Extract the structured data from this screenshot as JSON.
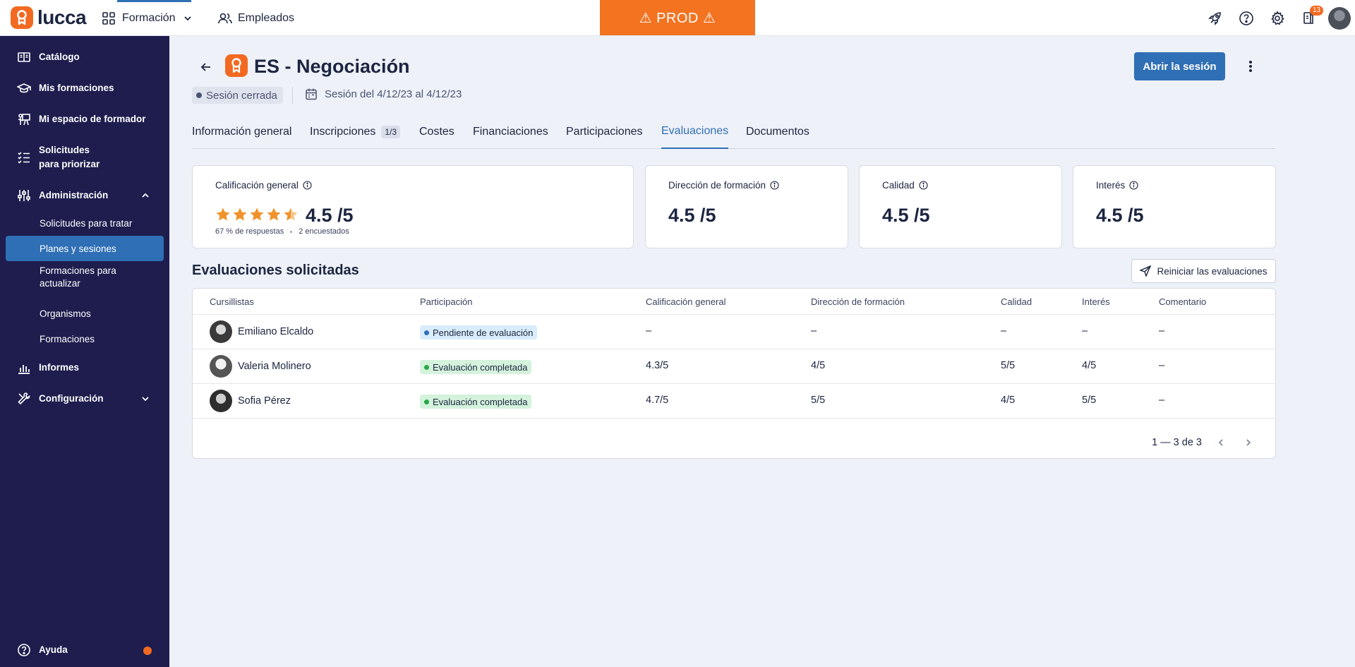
{
  "brand": {
    "name": "lucca",
    "accent": "#f26a21",
    "primary": "#2f6fb5",
    "sidebar_bg": "#1e1d4e"
  },
  "topbar": {
    "app_name": "Formación",
    "employees_link": "Empleados",
    "env_banner": "⚠ PROD ⚠",
    "icons": [
      "rocket-icon",
      "help-icon",
      "settings-icon",
      "notifications-icon"
    ],
    "notifications_count": "13"
  },
  "sidebar": {
    "items": [
      {
        "label": "Catálogo",
        "icon": "catalog-icon"
      },
      {
        "label": "Mis formaciones",
        "icon": "graduation-cap-icon"
      },
      {
        "label": "Mi espacio de formador",
        "icon": "presentation-icon"
      },
      {
        "label": "Solicitudes para priorizar",
        "icon": "list-check-icon"
      },
      {
        "label": "Administración",
        "icon": "sliders-icon",
        "expanded": true
      },
      {
        "label": "Informes",
        "icon": "bar-chart-icon"
      },
      {
        "label": "Configuración",
        "icon": "tools-icon",
        "expanded": false
      }
    ],
    "admin_subitems": [
      {
        "label": "Solicitudes para tratar",
        "active": false
      },
      {
        "label": "Planes y sesiones",
        "active": true
      },
      {
        "label": "Formaciones para actualizar",
        "active": false
      },
      {
        "label": "Organismos",
        "active": false
      },
      {
        "label": "Formaciones",
        "active": false
      }
    ],
    "help_label": "Ayuda"
  },
  "header": {
    "title": "ES - Negociación",
    "status": "Sesión cerrada",
    "dates": "Sesión del 4/12/23 al 4/12/23",
    "open_button": "Abrir la sesión"
  },
  "tabs": [
    {
      "label": "Información general",
      "active": false
    },
    {
      "label": "Inscripciones",
      "count": "1/3",
      "active": false
    },
    {
      "label": "Costes",
      "active": false
    },
    {
      "label": "Financiaciones",
      "active": false
    },
    {
      "label": "Participaciones",
      "active": false
    },
    {
      "label": "Evaluaciones",
      "active": true
    },
    {
      "label": "Documentos",
      "active": false
    }
  ],
  "scores": {
    "overall": {
      "label": "Calificación general",
      "value": "4.5 /5",
      "stars": 4.5,
      "responses": "67 % de respuestas",
      "surveyed": "2 encuestados"
    },
    "direction": {
      "label": "Dirección de formación",
      "value": "4.5 /5"
    },
    "quality": {
      "label": "Calidad",
      "value": "4.5 /5"
    },
    "interest": {
      "label": "Interés",
      "value": "4.5 /5"
    }
  },
  "evaluations": {
    "title": "Evaluaciones solicitadas",
    "reset_button": "Reiniciar las evaluaciones",
    "columns": [
      "Cursillistas",
      "Participación",
      "Calificación general",
      "Dirección de formación",
      "Calidad",
      "Interés",
      "Comentario"
    ],
    "rows": [
      {
        "name": "Emiliano Elcaldo",
        "status": "Pendiente de evaluación",
        "status_type": "pending",
        "overall": "–",
        "direction": "–",
        "quality": "–",
        "interest": "–",
        "comment": "–"
      },
      {
        "name": "Valeria Molinero",
        "status": "Evaluación completada",
        "status_type": "done",
        "overall": "4.3/5",
        "direction": "4/5",
        "quality": "5/5",
        "interest": "4/5",
        "comment": "–"
      },
      {
        "name": "Sofia Pérez",
        "status": "Evaluación completada",
        "status_type": "done",
        "overall": "4.7/5",
        "direction": "5/5",
        "quality": "4/5",
        "interest": "5/5",
        "comment": "–"
      }
    ],
    "pagination": "1 — 3 de 3"
  }
}
